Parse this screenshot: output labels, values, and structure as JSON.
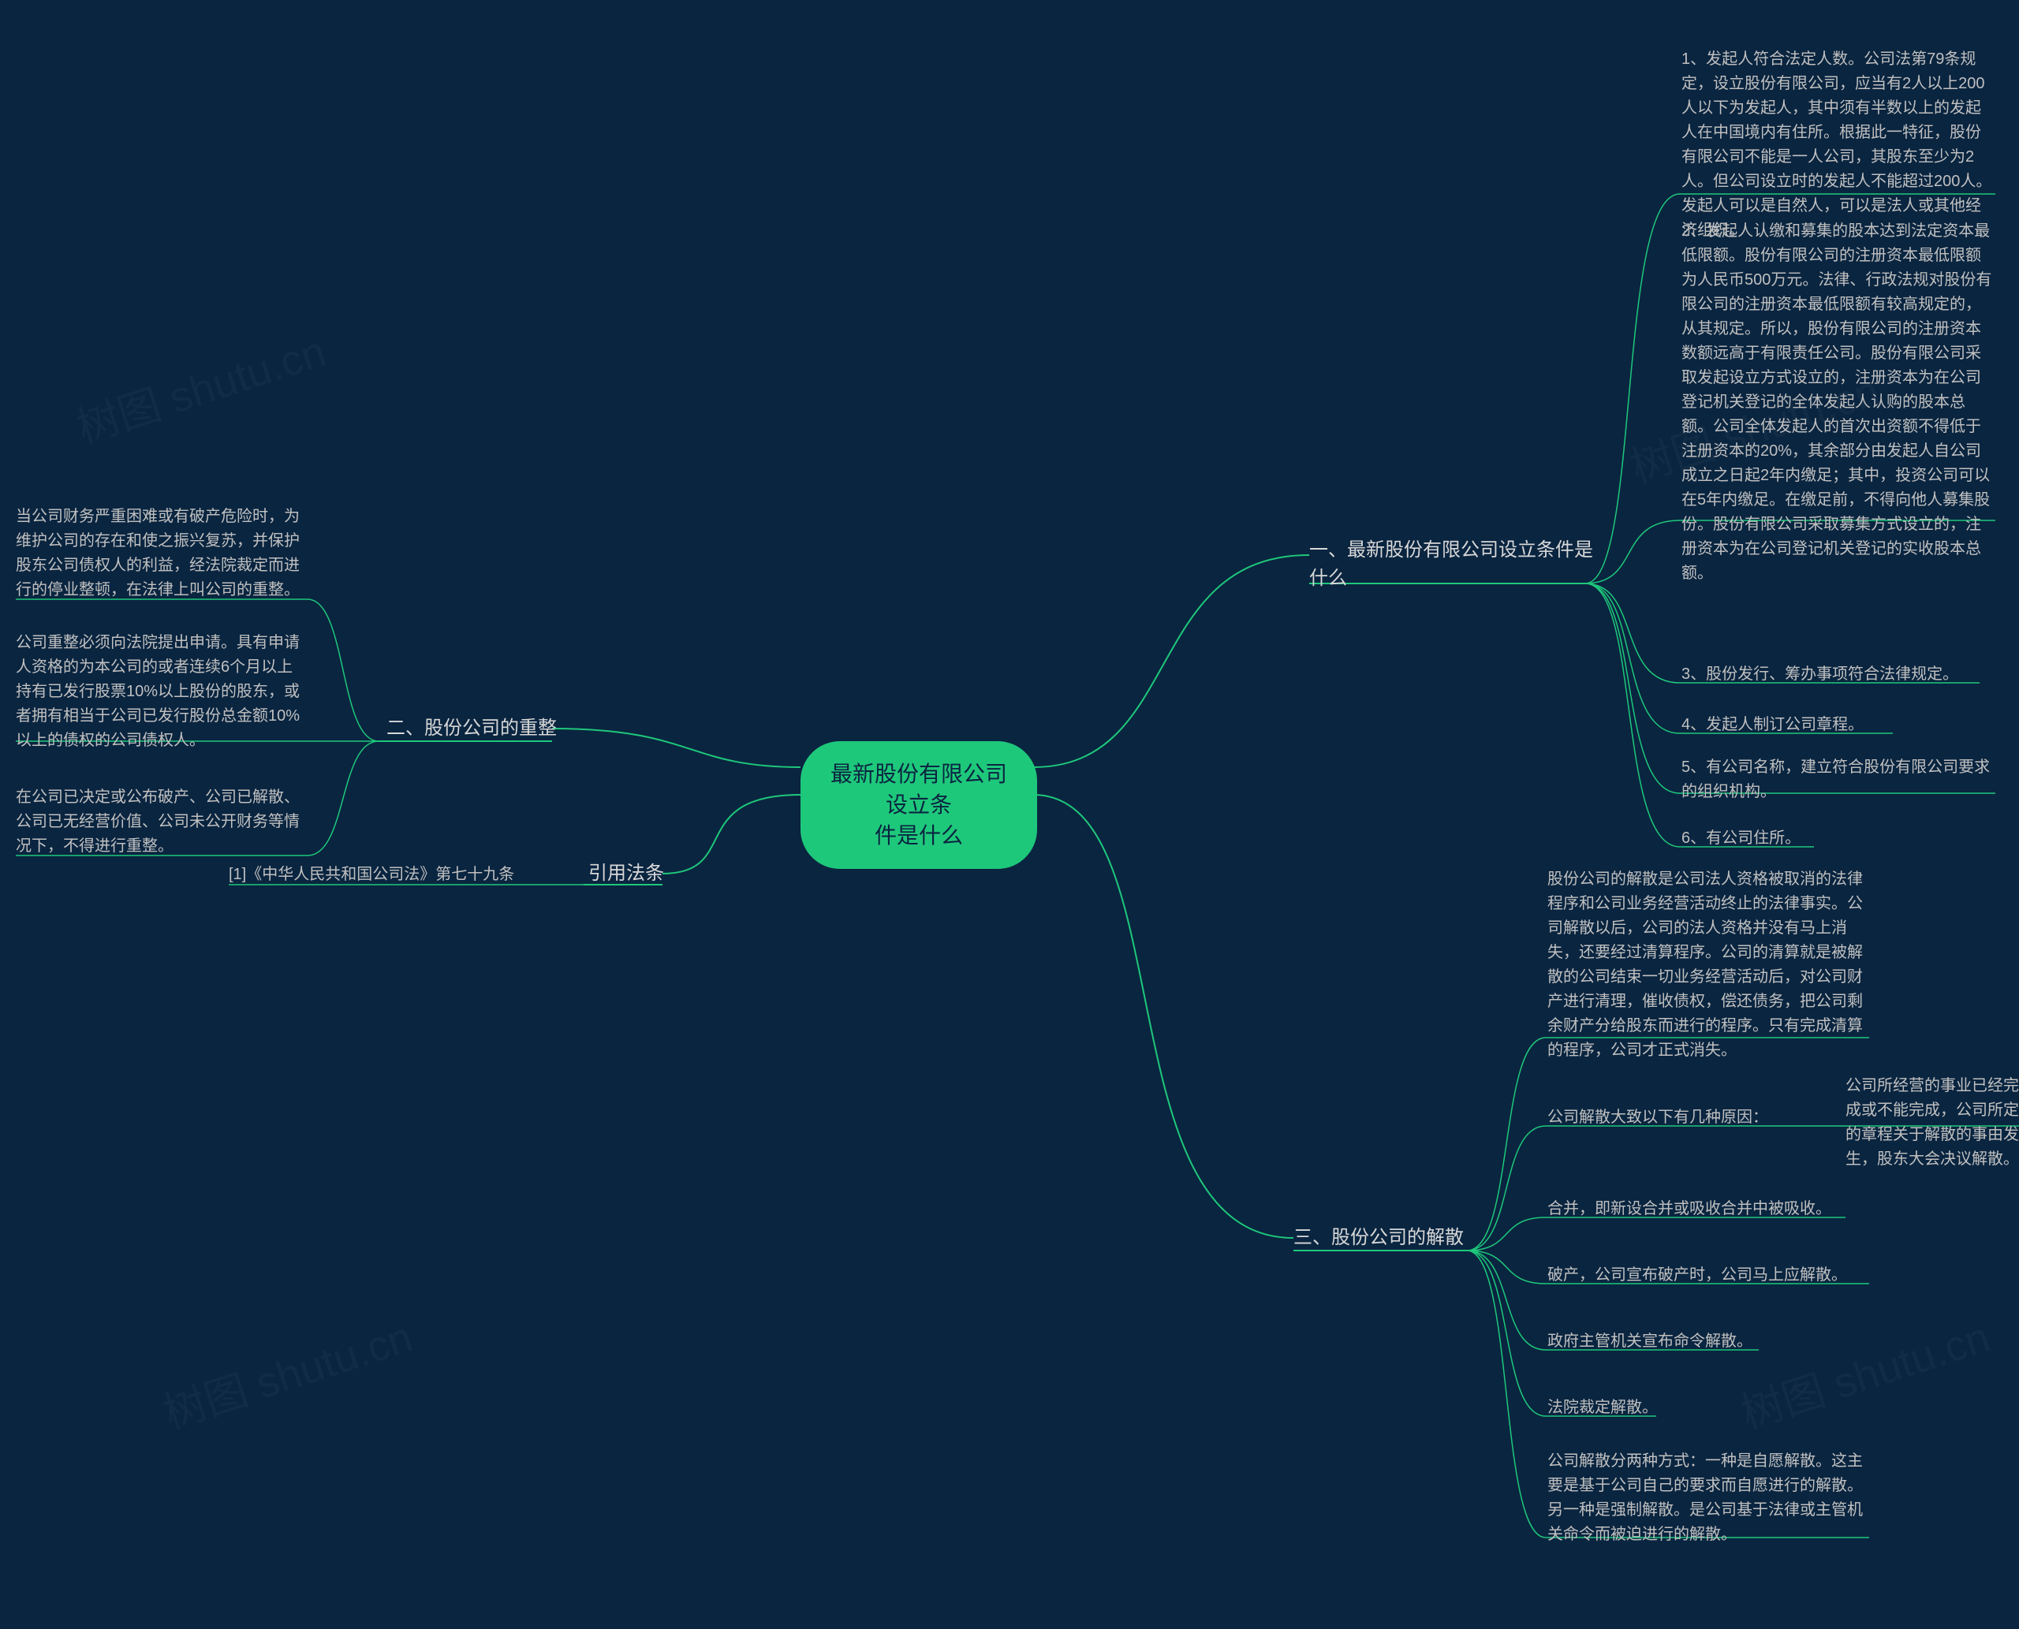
{
  "central": "最新股份有限公司设立条\n件是什么",
  "nodes": {
    "n1": "一、最新股份有限公司设立条件是\n什么",
    "n2": "二、股份公司的重整",
    "n3": "三、股份公司的解散",
    "n4": "引用法条"
  },
  "n1_children": {
    "c1": "1、发起人符合法定人数。公司法第79条规定，设立股份有限公司，应当有2人以上200人以下为发起人，其中须有半数以上的发起人在中国境内有住所。根据此一特征，股份有限公司不能是一人公司，其股东至少为2人。但公司设立时的发起人不能超过200人。发起人可以是自然人，可以是法人或其他经济组织。",
    "c2": "2、发起人认缴和募集的股本达到法定资本最低限额。股份有限公司的注册资本最低限额为人民币500万元。法律、行政法规对股份有限公司的注册资本最低限额有较高规定的，从其规定。所以，股份有限公司的注册资本数额远高于有限责任公司。股份有限公司采取发起设立方式设立的，注册资本为在公司登记机关登记的全体发起人认购的股本总额。公司全体发起人的首次出资额不得低于注册资本的20%，其余部分由发起人自公司成立之日起2年内缴足；其中，投资公司可以在5年内缴足。在缴足前，不得向他人募集股份。股份有限公司采取募集方式设立的，注册资本为在公司登记机关登记的实收股本总额。",
    "c3": "3、股份发行、筹办事项符合法律规定。",
    "c4": "4、发起人制订公司章程。",
    "c5": "5、有公司名称，建立符合股份有限公司要求的组织机构。",
    "c6": "6、有公司住所。"
  },
  "n2_children": {
    "c1": "当公司财务严重困难或有破产危险时，为维护公司的存在和使之振兴复苏，并保护股东公司债权人的利益，经法院裁定而进行的停业整顿，在法律上叫公司的重整。",
    "c2": "公司重整必须向法院提出申请。具有申请人资格的为本公司的或者连续6个月以上持有已发行股票10%以上股份的股东，或者拥有相当于公司已发行股份总金额10%以上的债权的公司债权人。",
    "c3": "在公司已决定或公布破产、公司已解散、公司已无经营价值、公司未公开财务等情况下，不得进行重整。"
  },
  "n3_children": {
    "c1": "股份公司的解散是公司法人资格被取消的法律程序和公司业务经营活动终止的法律事实。公司解散以后，公司的法人资格并没有马上消失，还要经过清算程序。公司的清算就是被解散的公司结束一切业务经营活动后，对公司财产进行清理，催收债权，偿还债务，把公司剩余财产分给股东而进行的程序。只有完成清算的程序，公司才正式消失。",
    "c2": "公司解散大致以下有几种原因：",
    "c2sub": "公司所经营的事业已经完成或不能完成，公司所定的章程关于解散的事由发生，股东大会决议解散。",
    "c3": "合并，即新设合并或吸收合并中被吸收。",
    "c4": "破产，公司宣布破产时，公司马上应解散。",
    "c5": "政府主管机关宣布命令解散。",
    "c6": "法院裁定解散。",
    "c7": "公司解散分两种方式：一种是自愿解散。这主要是基于公司自己的要求而自愿进行的解散。另一种是强制解散。是公司基于法律或主管机关命令而被迫进行的解散。"
  },
  "n4_children": {
    "c1": "[1]《中华人民共和国公司法》第七十九条"
  },
  "watermark": "树图 shutu.cn"
}
